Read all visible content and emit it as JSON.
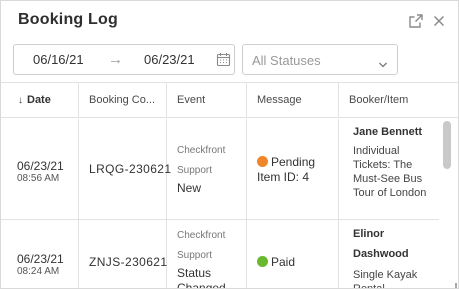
{
  "header": {
    "title": "Booking Log",
    "open_external_icon": "external-link-icon",
    "close_icon": "close-icon"
  },
  "filters": {
    "date_from": "06/16/21",
    "date_to": "06/23/21",
    "calendar_icon": "calendar-icon",
    "status_placeholder": "All Statuses"
  },
  "table": {
    "columns": [
      "Date",
      "Booking Co...",
      "Event",
      "Message",
      "Booker/Item"
    ],
    "sort_column": "Date",
    "sort_direction": "descending",
    "rows": [
      {
        "date": "06/23/21",
        "time": "08:56 AM",
        "code": "LRQG-230621",
        "event_source_line1": "Checkfront",
        "event_source_line2": "Support",
        "event_type": "New",
        "message_status": "Pending",
        "message_detail": "Item ID: 4",
        "status_color": "#f0862a",
        "booker": "Jane Bennett",
        "item": "Individual Tickets: The Must-See Bus Tour of London"
      },
      {
        "date": "06/23/21",
        "time": "08:24 AM",
        "code": "ZNJS-230621",
        "event_source_line1": "Checkfront",
        "event_source_line2": "Support",
        "event_type": "Status Changed",
        "message_status": "Paid",
        "message_detail": "",
        "status_color": "#6ab82e",
        "booker": "Elinor Dashwood",
        "item": "Single Kayak Rental"
      }
    ]
  }
}
